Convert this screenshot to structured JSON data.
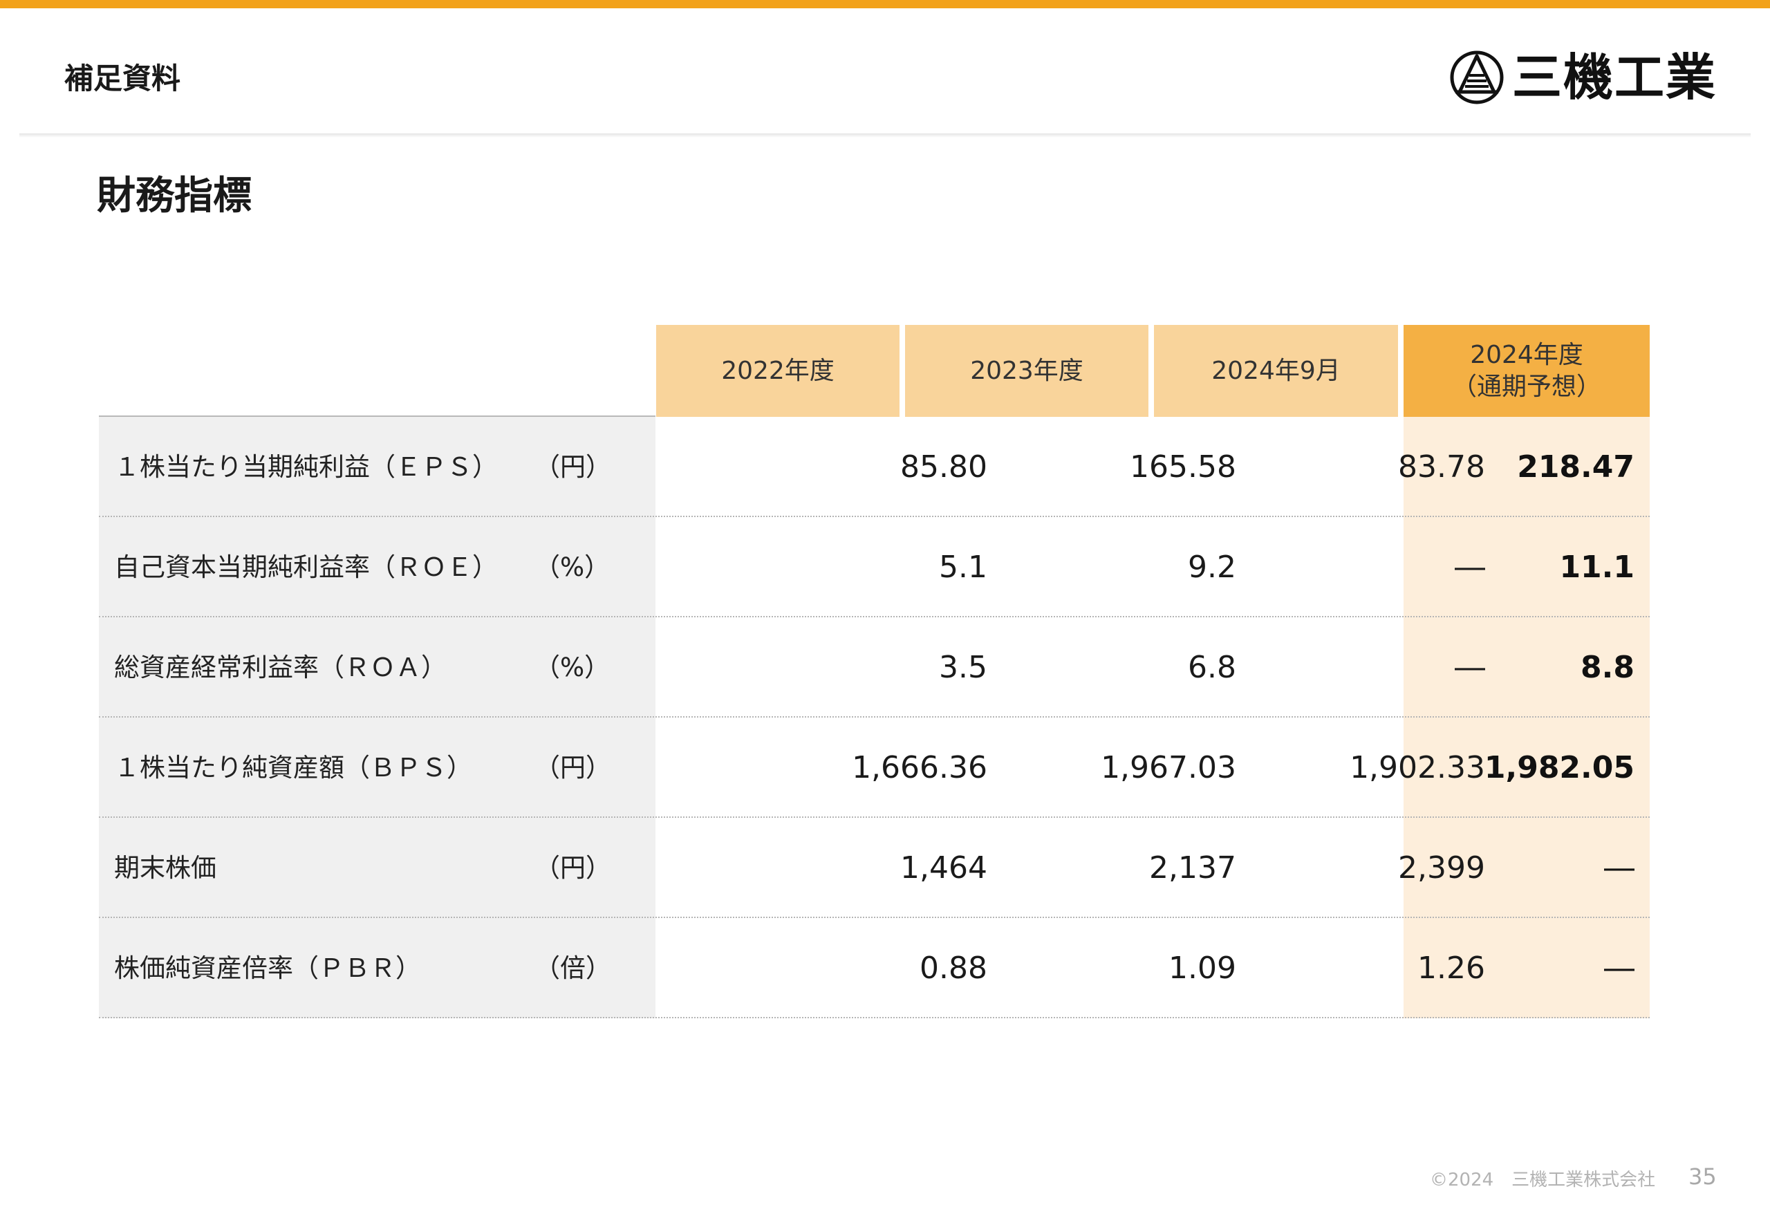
{
  "header": {
    "section_label": "補足資料",
    "logo_text": "三機工業",
    "logo_icon": "sanki-logo-icon"
  },
  "page_title": "財務指標",
  "table": {
    "columns": [
      "2022年度",
      "2023年度",
      "2024年9月",
      "2024年度",
      "（通期予想）"
    ],
    "rows": [
      {
        "label": "１株当たり当期純利益（ＥＰＳ）",
        "unit": "（円）",
        "values": [
          "85.80",
          "165.58",
          "83.78",
          "218.47"
        ]
      },
      {
        "label": "自己資本当期純利益率（ＲＯＥ）",
        "unit": "（%）",
        "values": [
          "5.1",
          "9.2",
          "―",
          "11.1"
        ]
      },
      {
        "label": "総資産経常利益率（ＲＯＡ）",
        "unit": "（%）",
        "values": [
          "3.5",
          "6.8",
          "―",
          "8.8"
        ]
      },
      {
        "label": "１株当たり純資産額（ＢＰＳ）",
        "unit": "（円）",
        "values": [
          "1,666.36",
          "1,967.03",
          "1,902.33",
          "1,982.05"
        ]
      },
      {
        "label": "期末株価",
        "unit": "（円）",
        "values": [
          "1,464",
          "2,137",
          "2,399",
          "―"
        ]
      },
      {
        "label": "株価純資産倍率（ＰＢＲ）",
        "unit": "（倍）",
        "values": [
          "0.88",
          "1.09",
          "1.26",
          "―"
        ]
      }
    ]
  },
  "footer": {
    "copyright": "©2024　三機工業株式会社",
    "page_number": "35"
  },
  "colors": {
    "accent_bar": "#f2a21b",
    "header_cell": "#f9d49b",
    "forecast_header": "#f4b044",
    "forecast_column": "#fdeedb",
    "label_column": "#f0f0f0"
  }
}
